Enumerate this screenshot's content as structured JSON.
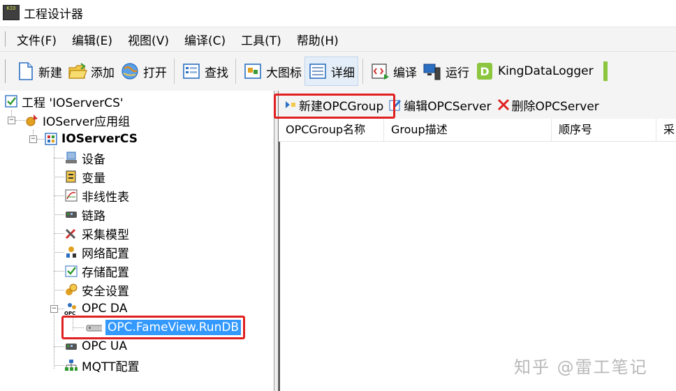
{
  "window": {
    "title": "工程设计器",
    "logo_text": "KIO"
  },
  "menubar": {
    "items": [
      "文件(F)",
      "编辑(E)",
      "视图(V)",
      "编译(C)",
      "工具(T)",
      "帮助(H)"
    ]
  },
  "toolbar": {
    "new": "新建",
    "add": "添加",
    "open": "打开",
    "find": "查找",
    "large_icons": "大图标",
    "details": "详细",
    "compile": "编译",
    "run": "运行",
    "kingdatalogger": "KingDataLogger"
  },
  "tree": {
    "project": "工程 'IOServerCS'",
    "group": "IOServer应用组",
    "server": "IOServerCS",
    "items": [
      "设备",
      "变量",
      "非线性表",
      "链路",
      "采集模型",
      "网络配置",
      "存储配置",
      "安全设置"
    ],
    "opc_da": "OPC DA",
    "opc_da_child": "OPC.FameView.RunDB",
    "opc_ua": "OPC UA",
    "mqtt": "MQTT配置"
  },
  "right_toolbar": {
    "new_group": "新建OPCGroup",
    "edit_server": "编辑OPCServer",
    "delete_server": "删除OPCServer"
  },
  "grid": {
    "columns": [
      "OPCGroup名称",
      "Group描述",
      "顺序号",
      "采"
    ]
  },
  "watermark": "知乎 @雷工笔记"
}
